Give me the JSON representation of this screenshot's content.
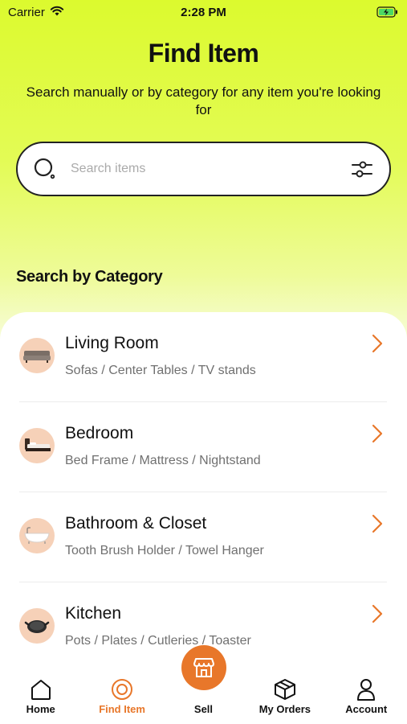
{
  "status_bar": {
    "carrier": "Carrier",
    "time": "2:28 PM",
    "icons": [
      "wifi-icon",
      "battery-charging-icon"
    ]
  },
  "header": {
    "title": "Find Item",
    "subtitle": "Search manually or by category for any item you're looking for"
  },
  "search": {
    "placeholder": "Search items",
    "value": "",
    "icons": [
      "search-icon",
      "filter-icon"
    ]
  },
  "section": {
    "title": "Search by Category"
  },
  "categories": [
    {
      "name": "Living Room",
      "subtitle": "Sofas / Center Tables / TV stands",
      "icon": "sofa-thumbnail"
    },
    {
      "name": "Bedroom",
      "subtitle": "Bed Frame / Mattress / Nightstand",
      "icon": "bed-thumbnail"
    },
    {
      "name": "Bathroom & Closet",
      "subtitle": "Tooth Brush Holder / Towel Hanger",
      "icon": "bathtub-thumbnail"
    },
    {
      "name": "Kitchen",
      "subtitle": "Pots / Plates / Cutleries / Toaster",
      "icon": "pan-thumbnail"
    }
  ],
  "tabs": [
    {
      "label": "Home",
      "icon": "home-icon",
      "active": false
    },
    {
      "label": "Find Item",
      "icon": "find-item-icon",
      "active": true
    },
    {
      "label": "Sell",
      "icon": "store-icon",
      "active": false
    },
    {
      "label": "My Orders",
      "icon": "box-icon",
      "active": false
    },
    {
      "label": "Account",
      "icon": "person-icon",
      "active": false
    }
  ],
  "colors": {
    "accent": "#e8772a",
    "header_gradient_top": "#dcfa2e",
    "thumbnail_bg": "#f6d1b8",
    "text_primary": "#111111",
    "text_secondary": "#707070"
  }
}
